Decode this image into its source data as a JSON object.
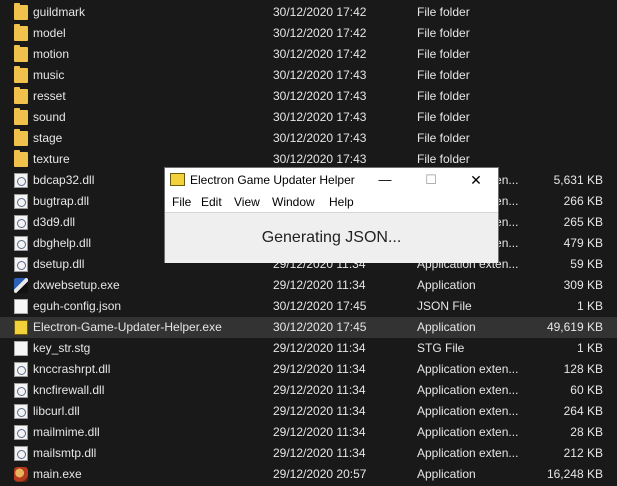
{
  "files": [
    {
      "name": "guildmark",
      "date": "30/12/2020 17:42",
      "type": "File folder",
      "size": "",
      "icon": "folder-icon"
    },
    {
      "name": "model",
      "date": "30/12/2020 17:42",
      "type": "File folder",
      "size": "",
      "icon": "folder-icon"
    },
    {
      "name": "motion",
      "date": "30/12/2020 17:42",
      "type": "File folder",
      "size": "",
      "icon": "folder-icon"
    },
    {
      "name": "music",
      "date": "30/12/2020 17:43",
      "type": "File folder",
      "size": "",
      "icon": "folder-icon"
    },
    {
      "name": "resset",
      "date": "30/12/2020 17:43",
      "type": "File folder",
      "size": "",
      "icon": "folder-icon"
    },
    {
      "name": "sound",
      "date": "30/12/2020 17:43",
      "type": "File folder",
      "size": "",
      "icon": "folder-icon"
    },
    {
      "name": "stage",
      "date": "30/12/2020 17:43",
      "type": "File folder",
      "size": "",
      "icon": "folder-icon"
    },
    {
      "name": "texture",
      "date": "30/12/2020 17:43",
      "type": "File folder",
      "size": "",
      "icon": "folder-icon"
    },
    {
      "name": "bdcap32.dll",
      "date": "",
      "type": "Application exten...",
      "size": "5,631 KB",
      "icon": "dll-icon"
    },
    {
      "name": "bugtrap.dll",
      "date": "",
      "type": "Application exten...",
      "size": "266 KB",
      "icon": "dll-icon"
    },
    {
      "name": "d3d9.dll",
      "date": "",
      "type": "Application exten...",
      "size": "265 KB",
      "icon": "dll-icon"
    },
    {
      "name": "dbghelp.dll",
      "date": "",
      "type": "Application exten...",
      "size": "479 KB",
      "icon": "dll-icon"
    },
    {
      "name": "dsetup.dll",
      "date": "29/12/2020 11:34",
      "type": "Application exten...",
      "size": "59 KB",
      "icon": "dll-icon"
    },
    {
      "name": "dxwebsetup.exe",
      "date": "29/12/2020 11:34",
      "type": "Application",
      "size": "309 KB",
      "icon": "directx-setup-icon"
    },
    {
      "name": "eguh-config.json",
      "date": "30/12/2020 17:45",
      "type": "JSON File",
      "size": "1 KB",
      "icon": "document-icon"
    },
    {
      "name": "Electron-Game-Updater-Helper.exe",
      "date": "30/12/2020 17:45",
      "type": "Application",
      "size": "49,619 KB",
      "icon": "updater-app-icon",
      "selected": true
    },
    {
      "name": "key_str.stg",
      "date": "29/12/2020 11:34",
      "type": "STG File",
      "size": "1 KB",
      "icon": "document-icon"
    },
    {
      "name": "knccrashrpt.dll",
      "date": "29/12/2020 11:34",
      "type": "Application exten...",
      "size": "128 KB",
      "icon": "dll-icon"
    },
    {
      "name": "kncfirewall.dll",
      "date": "29/12/2020 11:34",
      "type": "Application exten...",
      "size": "60 KB",
      "icon": "dll-icon"
    },
    {
      "name": "libcurl.dll",
      "date": "29/12/2020 11:34",
      "type": "Application exten...",
      "size": "264 KB",
      "icon": "dll-icon"
    },
    {
      "name": "mailmime.dll",
      "date": "29/12/2020 11:34",
      "type": "Application exten...",
      "size": "28 KB",
      "icon": "dll-icon"
    },
    {
      "name": "mailsmtp.dll",
      "date": "29/12/2020 11:34",
      "type": "Application exten...",
      "size": "212 KB",
      "icon": "dll-icon"
    },
    {
      "name": "main.exe",
      "date": "29/12/2020 20:57",
      "type": "Application",
      "size": "16,248 KB",
      "icon": "game-exe-icon"
    }
  ],
  "dialog": {
    "title": "Electron Game Updater Helper",
    "app_icon": "eguh-app-icon",
    "minimize": "—",
    "maximize": "☐",
    "close": "✕",
    "menu": [
      "File",
      "Edit",
      "View",
      "Window",
      "Help"
    ],
    "status": "Generating JSON..."
  }
}
